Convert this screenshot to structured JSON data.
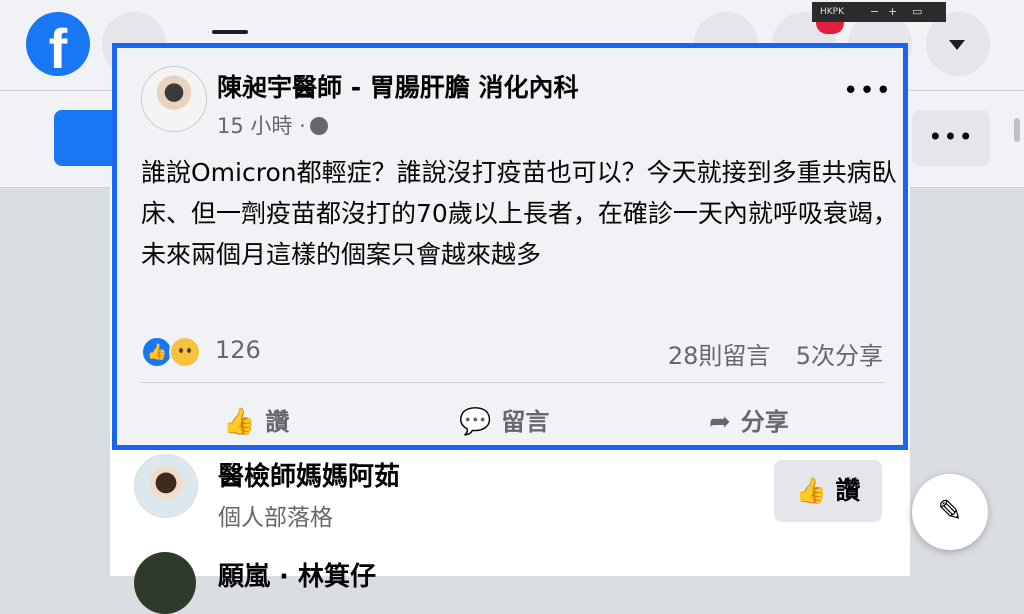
{
  "nav": {
    "logo_letter": "f"
  },
  "mini_window": {
    "title": "HKPK",
    "minus": "−",
    "plus": "+"
  },
  "header": {
    "more": "•••"
  },
  "post": {
    "author": "陳昶宇醫師 - 胃腸肝膽 消化內科",
    "time": "15 小時 ·",
    "more": "•••",
    "text": "誰說Omicron都輕症？誰說沒打疫苗也可以？今天就接到多重共病臥床、但一劑疫苗都沒打的70歲以上長者，在確診一天內就呼吸衰竭，未來兩個月這樣的個案只會越來越多",
    "reaction_count": "126",
    "comments": "28則留言",
    "shares": "5次分享",
    "actions": {
      "like": "讚",
      "comment": "留言",
      "share": "分享"
    }
  },
  "suggestions": [
    {
      "name": "醫檢師媽媽阿茹",
      "type": "個人部落格",
      "button": "讚"
    },
    {
      "name": "願嵐 · 林箕仔"
    }
  ],
  "icons": {
    "like": "thumbs-up-icon",
    "comment": "speech-bubble-icon",
    "share": "share-arrow-icon",
    "globe": "globe-icon",
    "compose": "compose-icon"
  },
  "colors": {
    "brand": "#1877f2",
    "highlight": "#1866f0",
    "badge": "#e41e3f"
  }
}
